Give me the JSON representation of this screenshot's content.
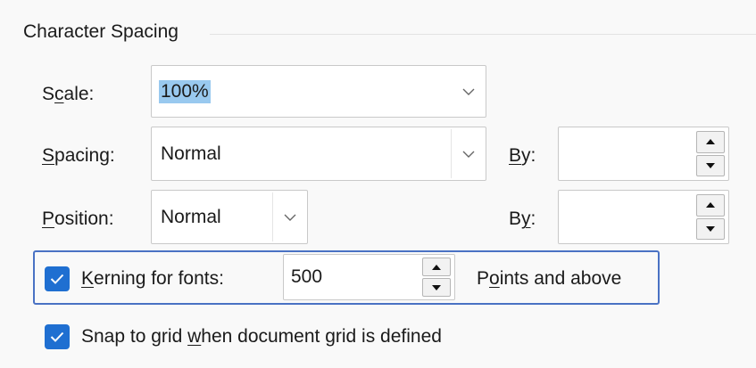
{
  "group": {
    "title": "Character Spacing"
  },
  "scale": {
    "label_pre": "S",
    "label_u": "c",
    "label_post": "ale:",
    "value": "100%"
  },
  "spacing": {
    "label_pre": "",
    "label_u": "S",
    "label_post": "pacing:",
    "value": "Normal",
    "by_pre": "",
    "by_u": "B",
    "by_post": "y:",
    "by_value": ""
  },
  "position": {
    "label_pre": "",
    "label_u": "P",
    "label_post": "osition:",
    "value": "Normal",
    "by_pre": "B",
    "by_u": "y",
    "by_post": ":",
    "by_value": ""
  },
  "kerning": {
    "checked": true,
    "label_pre": "",
    "label_u": "K",
    "label_post": "erning for fonts:",
    "value": "500",
    "suffix_pre": "P",
    "suffix_u": "o",
    "suffix_post": "ints and above"
  },
  "snap": {
    "checked": true,
    "label_pre": "Snap to grid ",
    "label_u": "w",
    "label_post": "hen document grid is defined"
  },
  "colors": {
    "accent": "#1f6fd1",
    "highlight_border": "#4a72c4",
    "selection": "#99c9ef"
  },
  "icons": {
    "dropdown": "chevron-down-icon",
    "spin_up": "triangle-up-icon",
    "spin_down": "triangle-down-icon",
    "check": "checkmark-icon"
  }
}
